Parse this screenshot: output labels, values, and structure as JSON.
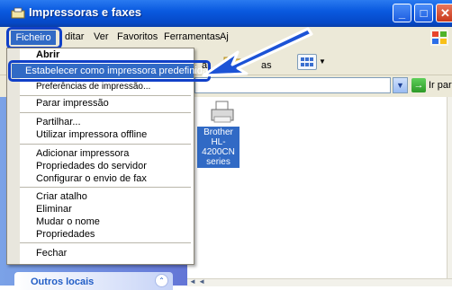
{
  "window": {
    "title": "Impressoras e faxes"
  },
  "menubar": {
    "items": [
      "Ficheiro",
      "ditar",
      "Ver",
      "Favoritos",
      "Ferramentas",
      "Aj"
    ]
  },
  "toolbar": {
    "partial_text": "ar",
    "folders_text": "as"
  },
  "addressbar": {
    "go_label": "Ir para"
  },
  "file_menu": {
    "abrir": "Abrir",
    "set_default": "Estabelecer como impressora predefinida",
    "preferences": "Preferências de impressão...",
    "pause": "Parar impressão",
    "share": "Partilhar...",
    "offline": "Utilizar impressora offline",
    "add_printer": "Adicionar impressora",
    "server_props": "Propriedades do servidor",
    "fax_setup": "Configurar o envio de fax",
    "create_shortcut": "Criar atalho",
    "delete": "Eliminar",
    "rename": "Mudar o nome",
    "properties": "Propriedades",
    "close": "Fechar"
  },
  "printer": {
    "label_line1": "Brother",
    "label_line2": "HL-4200CN",
    "label_line3": "series"
  },
  "taskpane": {
    "section_title": "Outros locais"
  },
  "colors": {
    "titlebar": "#0a5ae0",
    "selection": "#316ac5",
    "highlight_outline": "#1040c8"
  }
}
